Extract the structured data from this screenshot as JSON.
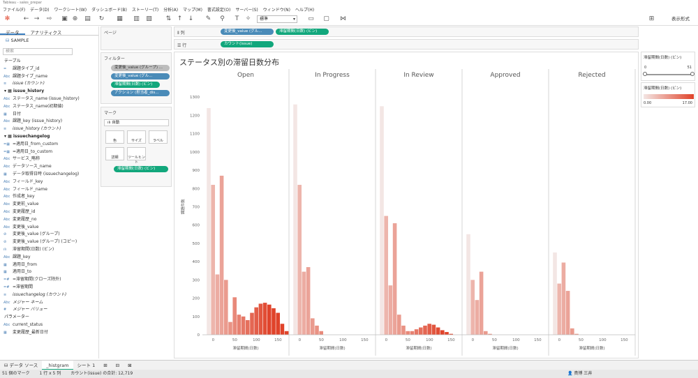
{
  "window": {
    "title": "Tableau - sales_prepar"
  },
  "menu": [
    "ファイル(F)",
    "データ(D)",
    "ワークシート(W)",
    "ダッシュボード(B)",
    "ストーリー(T)",
    "分析(A)",
    "マップ(M)",
    "書式設定(O)",
    "サーバー(S)",
    "ウィンドウ(N)",
    "ヘルプ(H)"
  ],
  "toolbar": {
    "view_size": "標準",
    "present_label": "表示形式"
  },
  "datapane": {
    "tabs": [
      "データ",
      "アナリティクス"
    ],
    "datasource": "SAMPLE",
    "search_placeholder": "検索",
    "items": [
      {
        "t": "sect",
        "label": "テーブル"
      },
      {
        "t": "f",
        "ico": "=",
        "label": "課題タイプ_id"
      },
      {
        "t": "f",
        "ico": "Abc",
        "label": "課題タイプ_name"
      },
      {
        "t": "f",
        "ico": "≡",
        "label": "issue (カウント)",
        "italic": true
      },
      {
        "t": "grp",
        "label": "issue_history"
      },
      {
        "t": "f",
        "ico": "Abc",
        "label": "ステータス_name (issue_history)"
      },
      {
        "t": "f",
        "ico": "Abc",
        "label": "ステータス_name(初期値)"
      },
      {
        "t": "f",
        "ico": "▦",
        "label": "日付"
      },
      {
        "t": "f",
        "ico": "Abc",
        "label": "課題_key (issue_history)"
      },
      {
        "t": "f",
        "ico": "≡",
        "label": "issue_history (カウント)",
        "italic": true
      },
      {
        "t": "grp",
        "label": "issuechangelog"
      },
      {
        "t": "f",
        "ico": "=▦",
        "label": "=適用日_from_custom"
      },
      {
        "t": "f",
        "ico": "=▦",
        "label": "=適用日_to_custom"
      },
      {
        "t": "f",
        "ico": "Abc",
        "label": "サービス_略称"
      },
      {
        "t": "f",
        "ico": "Abc",
        "label": "データソース_name"
      },
      {
        "t": "f",
        "ico": "▦",
        "label": "データ取得日時 (issuechangelog)"
      },
      {
        "t": "f",
        "ico": "Abc",
        "label": "フィールド_key"
      },
      {
        "t": "f",
        "ico": "Abc",
        "label": "フィールド_name"
      },
      {
        "t": "f",
        "ico": "Abc",
        "label": "作成者_key"
      },
      {
        "t": "f",
        "ico": "Abc",
        "label": "変更前_value"
      },
      {
        "t": "f",
        "ico": "Abc",
        "label": "変更履歴_id"
      },
      {
        "t": "f",
        "ico": "Abc",
        "label": "変更履歴_no"
      },
      {
        "t": "f",
        "ico": "Abc",
        "label": "変更後_value"
      },
      {
        "t": "f",
        "ico": "⊘",
        "label": "変更後_value (グループ)"
      },
      {
        "t": "f",
        "ico": "⊘",
        "label": "変更後_value (グループ) (コピー)"
      },
      {
        "t": "f",
        "ico": "ılı",
        "label": "滞留期間(日数) (ビン)"
      },
      {
        "t": "f",
        "ico": "Abc",
        "label": "課題_key"
      },
      {
        "t": "f",
        "ico": "▦",
        "label": "適用日_from"
      },
      {
        "t": "f",
        "ico": "▦",
        "label": "適用日_to"
      },
      {
        "t": "f",
        "ico": "=#",
        "label": "=滞留期間(クローズ除外)"
      },
      {
        "t": "f",
        "ico": "=#",
        "label": "=滞留期間"
      },
      {
        "t": "f",
        "ico": "≡",
        "label": "issuechangelog (カウント)",
        "italic": true
      },
      {
        "t": "f",
        "ico": "Abc",
        "label": "メジャー ネーム",
        "italic": true
      },
      {
        "t": "f",
        "ico": "#",
        "label": "メジャー バリュー",
        "italic": true
      },
      {
        "t": "sect",
        "label": "パラメーター"
      },
      {
        "t": "f",
        "ico": "Abc",
        "label": "current_status"
      },
      {
        "t": "f",
        "ico": "▦",
        "label": "変更履歴_最新日付"
      }
    ]
  },
  "pages": {
    "title": "ページ"
  },
  "filters": {
    "title": "フィルター",
    "pills": [
      {
        "label": "変更後_value (グループ) ...",
        "style": "gray"
      },
      {
        "label": "変更後_value (グル...",
        "style": "blue"
      },
      {
        "label": "滞留期間(日数) (ビン)",
        "style": "green"
      },
      {
        "label": "アクション (担当者_dis...",
        "style": "blue"
      }
    ]
  },
  "marks": {
    "title": "マーク",
    "type": "自動",
    "buttons": [
      "色",
      "サイズ",
      "ラベル",
      "詳細",
      "ツールヒント"
    ],
    "pill": "滞留期間(日数) (ビン)"
  },
  "columns_shelf": {
    "label": "列",
    "pills": [
      {
        "label": "変更後_value (グル...",
        "style": "blue"
      },
      {
        "label": "滞留期間(日数) (ビン)",
        "style": "green"
      }
    ]
  },
  "rows_shelf": {
    "label": "行",
    "pills": [
      {
        "label": "カウント(issue)",
        "style": "green"
      }
    ]
  },
  "legends": {
    "slider": {
      "title": "滞留期間(日数) (ビン)",
      "min": "0",
      "max": "51"
    },
    "color": {
      "title": "滞留期間(日数) (ビン)",
      "min": "0.00",
      "max": "17.00"
    }
  },
  "chart_data": {
    "type": "bar",
    "title": "ステータス別の滞留日数分布",
    "ylabel": "課題件数",
    "xlabel": "滞留期間(日数)",
    "ylim": [
      0,
      1400
    ],
    "yticks": [
      0,
      100,
      200,
      300,
      400,
      500,
      600,
      700,
      800,
      900,
      1000,
      1100,
      1200,
      1300
    ],
    "xticks": [
      0,
      50,
      100,
      150
    ],
    "bin_width": 10,
    "color_low": "#f3e6e4",
    "color_high": "#e0432a",
    "panels": [
      {
        "name": "Open",
        "x": [
          -10,
          0,
          10,
          20,
          30,
          40,
          50,
          60,
          70,
          80,
          90,
          100,
          110,
          120,
          130,
          140,
          150,
          160,
          170
        ],
        "values": [
          1240,
          820,
          330,
          870,
          300,
          70,
          205,
          110,
          100,
          80,
          120,
          150,
          170,
          175,
          165,
          145,
          120,
          60,
          20
        ]
      },
      {
        "name": "In Progress",
        "x": [
          -10,
          0,
          10,
          20,
          30,
          40,
          50
        ],
        "values": [
          1260,
          820,
          345,
          370,
          90,
          50,
          20
        ]
      },
      {
        "name": "In Review",
        "x": [
          -10,
          0,
          10,
          20,
          30,
          40,
          50,
          60,
          70,
          80,
          90,
          100,
          110,
          120,
          130,
          140,
          150
        ],
        "values": [
          1250,
          650,
          270,
          610,
          110,
          50,
          20,
          20,
          30,
          40,
          50,
          60,
          55,
          40,
          25,
          15,
          5
        ]
      },
      {
        "name": "Approved",
        "x": [
          -10,
          0,
          10,
          20,
          30,
          40
        ],
        "values": [
          550,
          300,
          190,
          345,
          20,
          5
        ]
      },
      {
        "name": "Rejected",
        "x": [
          -10,
          0,
          10,
          20,
          30,
          40
        ],
        "values": [
          450,
          280,
          395,
          240,
          35,
          5
        ]
      }
    ]
  },
  "sheettabs": [
    "データ ソース",
    "_histgram",
    "シート 1"
  ],
  "status": {
    "marks": "51 個のマーク",
    "dims": "1 行 x 5 列",
    "sum": "カウント(issue) の合計: 12,719",
    "user": "貴博 三井"
  }
}
